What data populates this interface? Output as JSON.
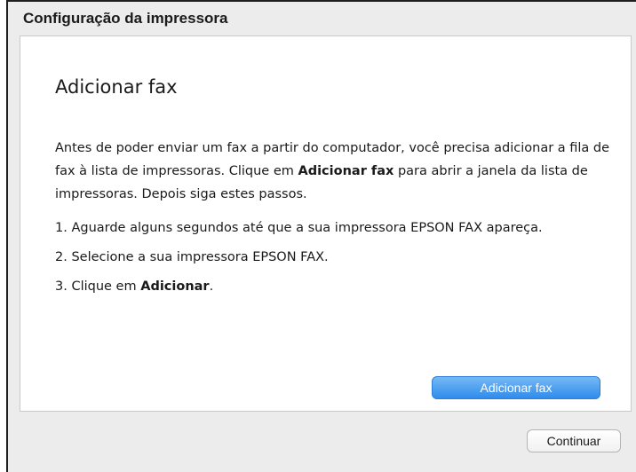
{
  "window": {
    "title": "Configuração da impressora"
  },
  "panel": {
    "heading": "Adicionar fax",
    "intro": {
      "part1": "Antes de poder enviar um fax a partir do computador, você precisa adicionar a fila de fax à lista de impressoras. Clique em ",
      "bold": "Adicionar fax",
      "part2": " para abrir a janela da lista de impressoras. Depois siga estes passos."
    },
    "steps": [
      {
        "text": "1. Aguarde alguns segundos até que a sua impressora EPSON FAX apareça."
      },
      {
        "text": "2. Selecione a sua impressora EPSON FAX."
      },
      {
        "prefix": "3. Clique em ",
        "bold": "Adicionar",
        "suffix": "."
      }
    ],
    "add_fax_button": "Adicionar fax"
  },
  "footer": {
    "continue_button": "Continuar"
  },
  "colors": {
    "primary_button": "#3a92ee",
    "window_background": "#ececec",
    "panel_background": "#ffffff"
  }
}
